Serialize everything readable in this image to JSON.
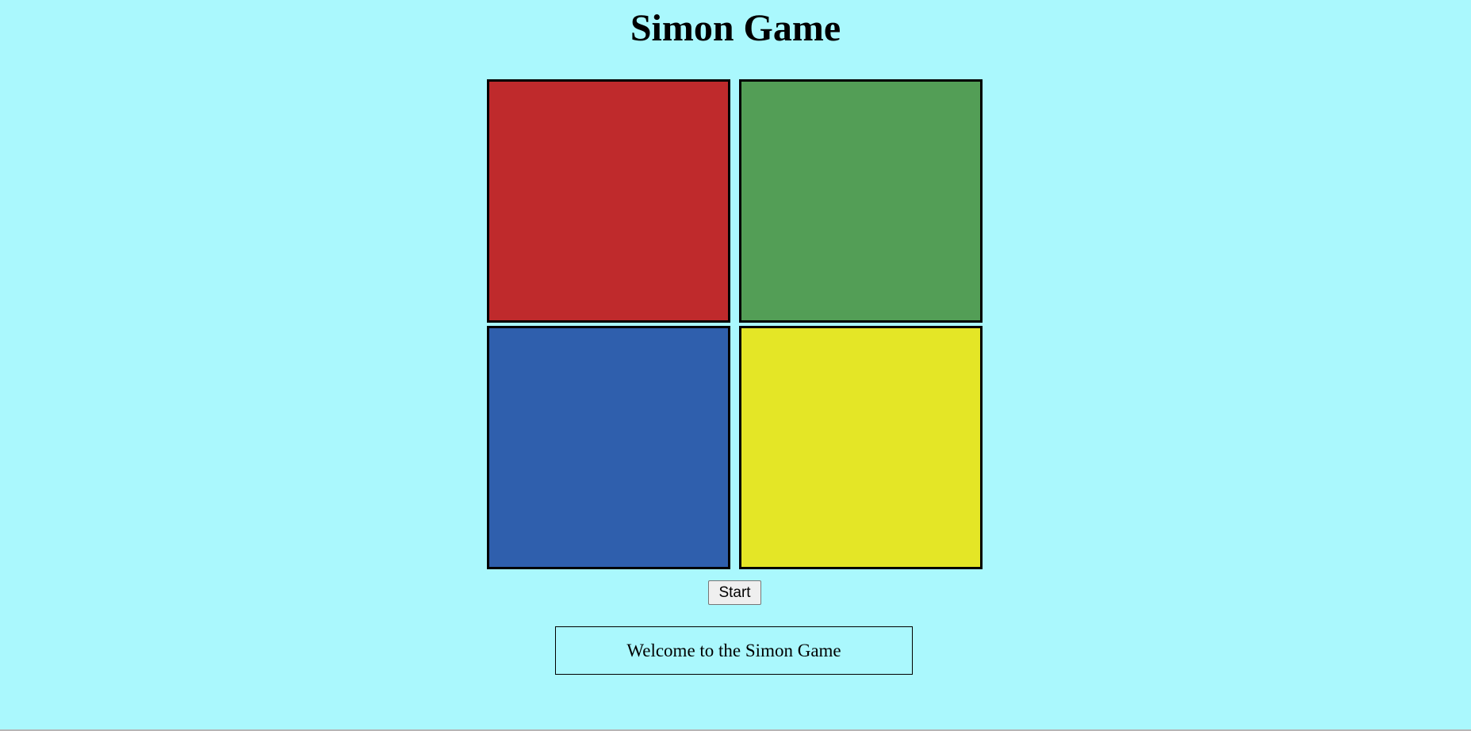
{
  "page": {
    "title": "Simon Game",
    "background": "#aaf8fd"
  },
  "pads": [
    {
      "name": "red",
      "color": "#bf2a2c"
    },
    {
      "name": "green",
      "color": "#539e56"
    },
    {
      "name": "blue",
      "color": "#2f5fad"
    },
    {
      "name": "yellow",
      "color": "#e4e626"
    }
  ],
  "controls": {
    "start_label": "Start"
  },
  "status": {
    "message": "Welcome to the Simon Game"
  }
}
